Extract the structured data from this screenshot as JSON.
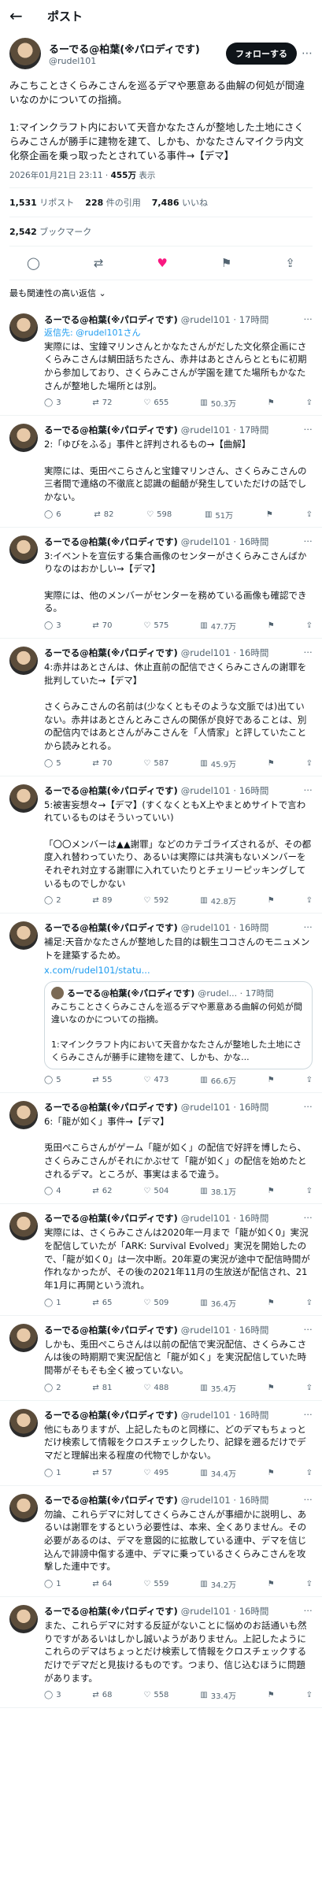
{
  "topbar": {
    "back_icon": "←",
    "title": "ポスト"
  },
  "post": {
    "display_name": "るーでる@柏葉(※パロディです)",
    "username": "@rudel101",
    "follow_label": "フォローする",
    "text": "みこちことさくらみこさんを巡るデマや悪意ある曲解の何処が間違いなのかについての指摘。\n\n1:マインクラフト内において天音かなたさんが整地した土地にさくらみこさんが勝手に建物を建て、しかも、かなたさんマイクラ内文化祭企画を乗っ取ったとされている事件→【デマ】",
    "timestamp": "2026年01月21日 23:11 · ",
    "views_num": "455万",
    "views_label": "表示",
    "reposts_num": "1,531",
    "reposts_label": "リポスト",
    "quotes_num": "228",
    "quotes_label": "件の引用",
    "likes_num": "7,486",
    "likes_label": "いいね",
    "bookmarks_num": "2,542",
    "bookmarks_label": "ブックマーク"
  },
  "sort_label": "最も関連性の高い返信 ⌄",
  "replies": [
    {
      "name": "るーでる@柏葉(※パロディです)",
      "meta": "@rudel101 · 17時間",
      "reply_to": "返信先: ",
      "reply_to_user": "@rudel101さん",
      "text": "実際には、宝鐘マリンさんとかなたさんがだした文化祭企画にさくらみこさんは鯛田話ちたさん、赤井はあとさんらとともに初期から参加しており、さくらみこさんが学園を建てた場所もかなたさんが整地した場所とは別。",
      "reply": "3",
      "rt": "72",
      "like": "655",
      "views": "50.3万"
    },
    {
      "name": "るーでる@柏葉(※パロディです)",
      "meta": "@rudel101 · 17時間",
      "text": "2:「ゆびをふる」事件と評判されるもの→【曲解】\n\n実際には、兎田ぺこらさんと宝鐘マリンさん、さくらみこさんの三者間で連絡の不徹底と認識の齟齬が発生していただけの話でしかない。",
      "reply": "6",
      "rt": "82",
      "like": "598",
      "views": "51万"
    },
    {
      "name": "るーでる@柏葉(※パロディです)",
      "meta": "@rudel101 · 16時間",
      "text": "3:イベントを宣伝する集合画像のセンターがさくらみこさんばかりなのはおかしい→【デマ】\n\n実際には、他のメンバーがセンターを務めている画像も確認できる。",
      "reply": "3",
      "rt": "70",
      "like": "575",
      "views": "47.7万"
    },
    {
      "name": "るーでる@柏葉(※パロディです)",
      "meta": "@rudel101 · 16時間",
      "text": "4:赤井はあとさんは、休止直前の配信でさくらみこさんの謝罪を批判していた→【デマ】\n\nさくらみこさんの名前は(少なくともそのような文脈では)出ていない。赤井はあとさんとみこさんの関係が良好であることは、別の配信内ではあとさんがみこさんを「人情家」と評していたことから読みとれる。",
      "reply": "5",
      "rt": "70",
      "like": "587",
      "views": "45.9万"
    },
    {
      "name": "るーでる@柏葉(※パロディです)",
      "meta": "@rudel101 · 16時間",
      "text": "5:被害妄想々→【デマ】(すくなくともX上やまとめサイトで言われているものはそういっていい)\n\n「〇〇メンバーは▲▲謝罪」などのカテゴライズされるが、その都度入れ替わっていたり、あるいは実際には共演もないメンバーをそれぞれ対立する謝罪に入れていたりとチェリーピッキングしているものでしかない",
      "reply": "2",
      "rt": "89",
      "like": "592",
      "views": "42.8万"
    },
    {
      "name": "るーでる@柏葉(※パロディです)",
      "meta": "@rudel101 · 16時間",
      "text": "補足:天音かなたさんが整地した目的は観生ココさんのモニュメントを建築するため。",
      "link": "x.com/rudel101/statu...",
      "quote": {
        "name": "るーでる@柏葉(※パロディです)",
        "meta": "@rudel... · 17時間",
        "text": "みこちことさくらみこさんを巡るデマや悪意ある曲解の何処が間違いなのかについての指摘。\n\n1:マインクラフト内において天音かなたさんが整地した土地にさくらみこさんが勝手に建物を建て、しかも、かな..."
      },
      "reply": "5",
      "rt": "55",
      "like": "473",
      "views": "66.6万"
    },
    {
      "name": "るーでる@柏葉(※パロディです)",
      "meta": "@rudel101 · 16時間",
      "text": "6:「龍が如く」事件→【デマ】\n\n兎田ぺこらさんがゲーム「龍が如く」の配信で好評を博したら、さくらみこさんがそれにかぶせて「龍が如く」の配信を始めたとされるデマ。ところが、事実はまるで違う。",
      "reply": "4",
      "rt": "62",
      "like": "504",
      "views": "38.1万"
    },
    {
      "name": "るーでる@柏葉(※パロディです)",
      "meta": "@rudel101 · 16時間",
      "text": "実際には、さくらみこさんは2020年一月まで「龍が如く0」実況を配信していたが「ARK: Survival Evolved」実況を開始したので、「龍が如く0」は一次中断。20年夏の実況が途中で配信時間が作れなかったが、その後の2021年11月の生放送が配信され、21年1月に再開という流れ。",
      "reply": "1",
      "rt": "65",
      "like": "509",
      "views": "36.4万"
    },
    {
      "name": "るーでる@柏葉(※パロディです)",
      "meta": "@rudel101 · 16時間",
      "text": "しかも、兎田ぺこらさんは以前の配信で実況配信、さくらみこさんは後の時期期で実況配信と「龍が如く」を実況配信していた時間帯がそもそも全く被っていない。",
      "reply": "2",
      "rt": "81",
      "like": "488",
      "views": "35.4万"
    },
    {
      "name": "るーでる@柏葉(※パロディです)",
      "meta": "@rudel101 · 16時間",
      "text": "他にもありますが、上記したものと同様に、どのデマもちょっとだけ検索して情報をクロスチェックしたり、記録を遡るだけでデマだと理解出来る程度の代物でしかない。",
      "reply": "1",
      "rt": "57",
      "like": "495",
      "views": "34.4万"
    },
    {
      "name": "るーでる@柏葉(※パロディです)",
      "meta": "@rudel101 · 16時間",
      "text": "勿論、これらデマに対してさくらみこさんが事細かに説明し、あるいは謝罪をするという必要性は、本来、全くありません。その必要があるのは、デマを意図的に拡散している連中、デマを信じ込んで誹謗中傷する連中、デマに乗っているさくらみこさんを攻撃した連中です。",
      "reply": "1",
      "rt": "64",
      "like": "559",
      "views": "34.2万"
    },
    {
      "name": "るーでる@柏葉(※パロディです)",
      "meta": "@rudel101 · 16時間",
      "text": "また、これらデマに対する反証がないことに悩めのお話通いも然りですがあるいはしかし誠いようがありません。上記したようにこれらのデマはちょっとだけ検索して情報をクロスチェックするだけでデマだと見抜けるものです。つまり、信じ込むほうに問題があります。",
      "reply": "3",
      "rt": "68",
      "like": "558",
      "views": "33.4万"
    }
  ]
}
